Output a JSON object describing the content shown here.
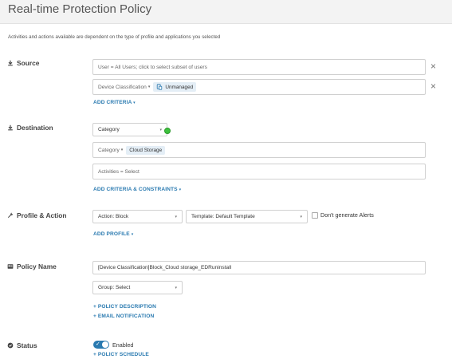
{
  "page": {
    "title": "Real-time Protection Policy",
    "subtitle": "Activities and actions available are dependent on the type of profile and applications you selected"
  },
  "source": {
    "label": "Source",
    "users_placeholder": "User = All Users; click to select subset of users",
    "device_label": "Device Classification",
    "device_caret": "▾",
    "device_value": "Unmanaged",
    "add_criteria": "ADD CRITERIA",
    "add_caret": "▾",
    "remove_icon": "×"
  },
  "destination": {
    "label": "Destination",
    "type_select": "Category",
    "category_label": "Category",
    "category_caret": "▾",
    "category_value": "Cloud Storage",
    "activities_text": "Activities = Select",
    "add_link": "ADD CRITERIA & CONSTRAINTS",
    "add_caret": "▾"
  },
  "profile_action": {
    "label": "Profile & Action",
    "action_select": "Action: Block",
    "template_select": "Template: Default Template",
    "dont_generate_alerts": "Don't generate Alerts",
    "add_profile": "ADD PROFILE",
    "add_caret": "▾"
  },
  "policy_name": {
    "label": "Policy Name",
    "value": "[Device Classification]Block_Cloud storage_EDRuninstall",
    "group_select": "Group: Select",
    "policy_description_link": "+ POLICY DESCRIPTION",
    "email_notification_link": "+ EMAIL NOTIFICATION"
  },
  "status": {
    "label": "Status",
    "toggle_text": "Enabled",
    "toggle_on": true,
    "toggle_tick": "✓",
    "policy_schedule_link": "+ POLICY SCHEDULE"
  },
  "icons": {
    "source": "download-arrow-icon",
    "destination": "download-arrow-icon",
    "profile": "wrench-icon",
    "policy_name": "id-card-icon",
    "status": "check-circle-icon",
    "device": "device-icon"
  },
  "colors": {
    "accent": "#2a7ab0",
    "chip_bg": "#e4eef6",
    "status_dot": "#3ec13e"
  }
}
